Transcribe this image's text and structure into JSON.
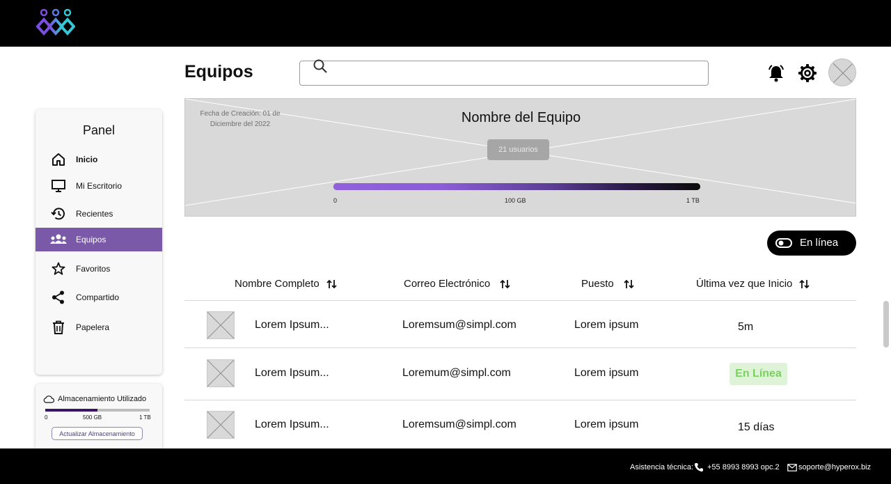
{
  "header": {
    "title": "Equipos",
    "search": {
      "placeholder": "",
      "value": ""
    }
  },
  "sidebar": {
    "title": "Panel",
    "items": [
      {
        "label": "Inicio",
        "icon": "home-icon",
        "bold": true
      },
      {
        "label": "Mi Escritorio",
        "icon": "monitor-icon"
      },
      {
        "label": "Recientes",
        "icon": "history-icon"
      },
      {
        "label": "Equipos",
        "icon": "team-icon",
        "active": true
      },
      {
        "label": "Favoritos",
        "icon": "star-icon"
      },
      {
        "label": "Compartido",
        "icon": "share-icon"
      },
      {
        "label": "Papelera",
        "icon": "trash-icon"
      }
    ],
    "storage": {
      "title": "Almacenamiento Utilizado",
      "used_fraction": 0.5,
      "ticks": [
        "0",
        "500 GB",
        "1 TB"
      ],
      "button": "Actualizar Almacenamiento"
    }
  },
  "banner": {
    "created": "Fecha de Creación: 01 de Diciembre del 2022",
    "team_name": "Nombre del Equipo",
    "users": "21 usuarios",
    "usage_fraction": 0.3,
    "ticks": [
      "0",
      "100 GB",
      "1 TB"
    ]
  },
  "online_toggle": {
    "label": "En línea"
  },
  "table": {
    "headers": [
      "Nombre Completo",
      "Correo Electrónico",
      "Puesto",
      "Última vez que Inicio"
    ],
    "rows": [
      {
        "name": "Lorem Ipsum...",
        "email": "Loremsum@simpl.com",
        "role": "Lorem ipsum",
        "last": "5m",
        "online": false
      },
      {
        "name": "Lorem Ipsum...",
        "email": "Loremum@simpl.com",
        "role": "Lorem ipsum",
        "last": "En Línea",
        "online": true
      },
      {
        "name": "Lorem Ipsum...",
        "email": "Loremsum@simpl.com",
        "role": "Lorem ipsum",
        "last": "15 días",
        "online": false
      }
    ]
  },
  "footer": {
    "label": "Asistencia técnica:",
    "phone": "+55 8993 8993 opc.2",
    "email": "soporte@hyperox.biz"
  },
  "colors": {
    "accent": "#7a5aa8",
    "online_bg": "#dff3d9",
    "online_text": "#7ad25e"
  }
}
